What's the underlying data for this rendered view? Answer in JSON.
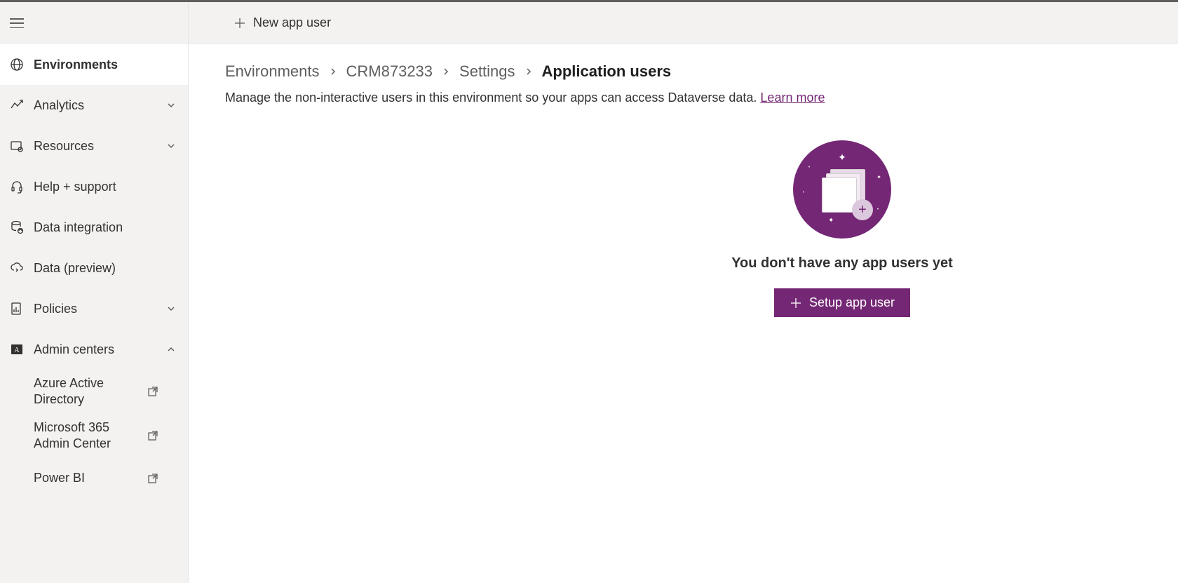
{
  "commandBar": {
    "newAppUser": "New app user"
  },
  "breadcrumb": {
    "items": [
      "Environments",
      "CRM873233",
      "Settings",
      "Application users"
    ]
  },
  "description": {
    "text": "Manage the non-interactive users in this environment so your apps can access Dataverse data. ",
    "learnMore": "Learn more"
  },
  "emptyState": {
    "title": "You don't have any app users yet",
    "button": "Setup app user"
  },
  "sidebar": {
    "items": [
      {
        "label": "Environments",
        "icon": "globe-icon",
        "active": true,
        "expandable": false
      },
      {
        "label": "Analytics",
        "icon": "chart-icon",
        "active": false,
        "expandable": true,
        "expanded": false
      },
      {
        "label": "Resources",
        "icon": "resources-icon",
        "active": false,
        "expandable": true,
        "expanded": false
      },
      {
        "label": "Help + support",
        "icon": "headset-icon",
        "active": false,
        "expandable": false
      },
      {
        "label": "Data integration",
        "icon": "database-icon",
        "active": false,
        "expandable": false
      },
      {
        "label": "Data (preview)",
        "icon": "cloud-sync-icon",
        "active": false,
        "expandable": false
      },
      {
        "label": "Policies",
        "icon": "doc-chart-icon",
        "active": false,
        "expandable": true,
        "expanded": false
      },
      {
        "label": "Admin centers",
        "icon": "admin-icon",
        "active": false,
        "expandable": true,
        "expanded": true
      }
    ],
    "adminCentersChildren": [
      {
        "label": "Azure Active Directory"
      },
      {
        "label": "Microsoft 365 Admin Center"
      },
      {
        "label": "Power BI"
      }
    ]
  }
}
